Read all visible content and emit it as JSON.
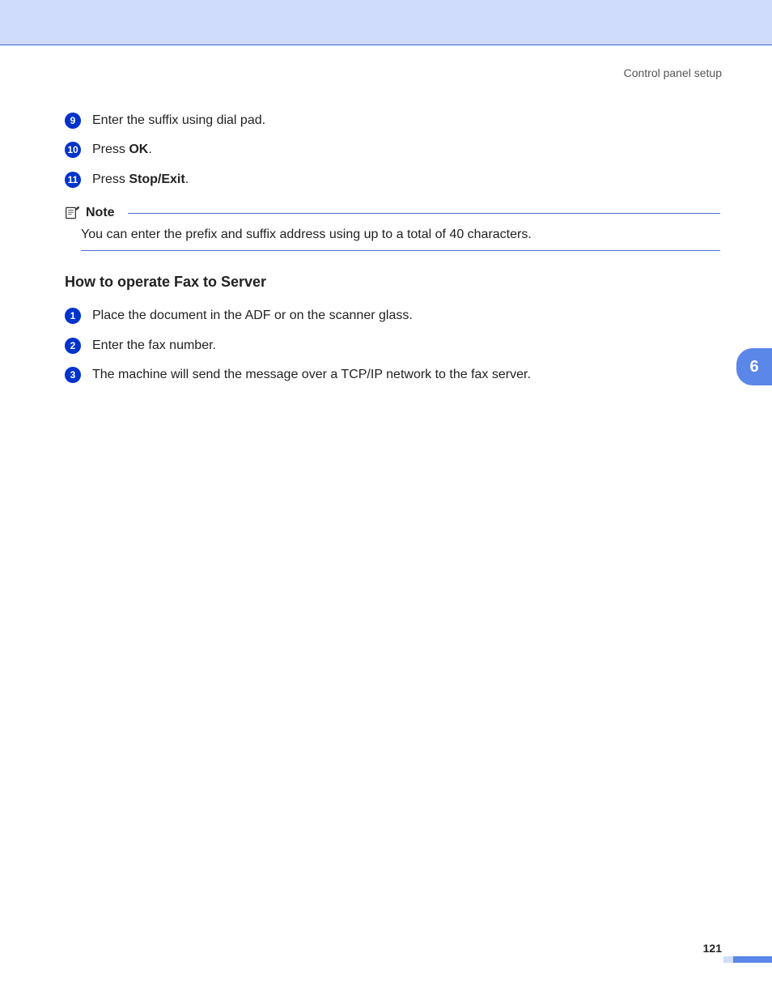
{
  "header": "Control panel setup",
  "steps_a": [
    {
      "num": "9",
      "text": "Enter the suffix using dial pad."
    },
    {
      "num": "10",
      "prefix": "Press ",
      "bold": "OK",
      "suffix": "."
    },
    {
      "num": "11",
      "prefix": "Press ",
      "bold": "Stop/Exit",
      "suffix": "."
    }
  ],
  "note": {
    "label": "Note",
    "body": "You can enter the prefix and suffix address using up to a total of 40 characters."
  },
  "section_heading": "How to operate Fax to Server",
  "steps_b": [
    {
      "num": "1",
      "text": "Place the document in the ADF or on the scanner glass."
    },
    {
      "num": "2",
      "text": "Enter the fax number."
    },
    {
      "num": "3",
      "text": "The machine will send the message over a TCP/IP network to the fax server."
    }
  ],
  "side_tab": "6",
  "page_number": "121"
}
